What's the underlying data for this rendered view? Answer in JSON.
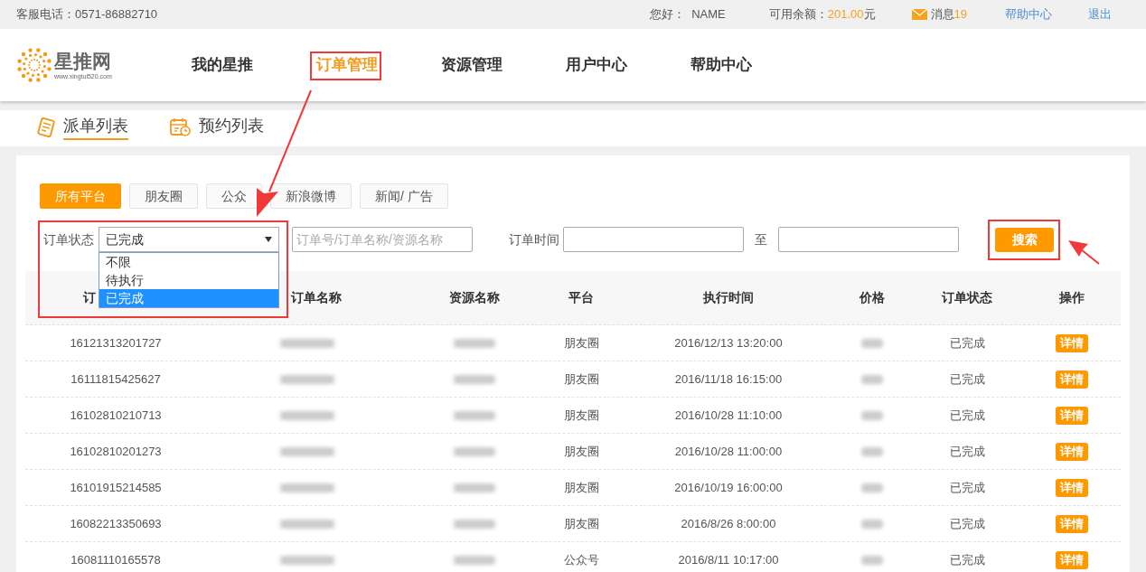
{
  "top_bar": {
    "phone": "客服电话：0571-86882710",
    "greeting": "您好：  NAME",
    "balance_label": "可用余额：",
    "balance_value": "201.00",
    "balance_unit": "元",
    "messages_label": "消息",
    "messages_count": "19",
    "links": [
      "帮助中心",
      "退出"
    ]
  },
  "logo": {
    "name": "星推网",
    "url": "www.xingtui520.com"
  },
  "nav": [
    {
      "label": "我的星推",
      "selected": false
    },
    {
      "label": "订单管理",
      "selected": true
    },
    {
      "label": "资源管理",
      "selected": false
    },
    {
      "label": "用户中心",
      "selected": false
    },
    {
      "label": "帮助中心",
      "selected": false
    }
  ],
  "subtabs": [
    {
      "label": "派单列表",
      "selected": true,
      "kind": "list"
    },
    {
      "label": "预约列表",
      "selected": false,
      "kind": "calendar"
    }
  ],
  "platforms": [
    {
      "label": "所有平台",
      "selected": true
    },
    {
      "label": "朋友圈",
      "selected": false
    },
    {
      "label": "公众",
      "selected": false
    },
    {
      "label": "新浪微博",
      "selected": false
    },
    {
      "label": "新闻/ 广告",
      "selected": false
    }
  ],
  "filters": {
    "status_label": "订单状态",
    "status_value": "已完成",
    "status_options": [
      {
        "label": "不限",
        "selected": false
      },
      {
        "label": "待执行",
        "selected": false
      },
      {
        "label": "已完成",
        "selected": true
      }
    ],
    "keyword_placeholder": "订单号/订单名称/资源名称",
    "time_label": "订单时间",
    "time_separator": "至",
    "search_button": "搜索"
  },
  "table": {
    "columns": [
      "订",
      "订单名称",
      "资源名称",
      "平台",
      "执行时间",
      "价格",
      "订单状态",
      "操作"
    ],
    "rows": [
      {
        "order_no": "16121313201727",
        "platform": "朋友圈",
        "time": "2016/12/13 13:20:00",
        "status": "已完成",
        "action": "详情"
      },
      {
        "order_no": "16111815425627",
        "platform": "朋友圈",
        "time": "2016/11/18 16:15:00",
        "status": "已完成",
        "action": "详情"
      },
      {
        "order_no": "16102810210713",
        "platform": "朋友圈",
        "time": "2016/10/28 11:10:00",
        "status": "已完成",
        "action": "详情"
      },
      {
        "order_no": "16102810201273",
        "platform": "朋友圈",
        "time": "2016/10/28 11:00:00",
        "status": "已完成",
        "action": "详情"
      },
      {
        "order_no": "16101915214585",
        "platform": "朋友圈",
        "time": "2016/10/19 16:00:00",
        "status": "已完成",
        "action": "详情"
      },
      {
        "order_no": "16082213350693",
        "platform": "朋友圈",
        "time": "2016/8/26 8:00:00",
        "status": "已完成",
        "action": "详情"
      },
      {
        "order_no": "16081110165578",
        "platform": "公众号",
        "time": "2016/8/11 10:17:00",
        "status": "已完成",
        "action": "详情"
      }
    ]
  }
}
